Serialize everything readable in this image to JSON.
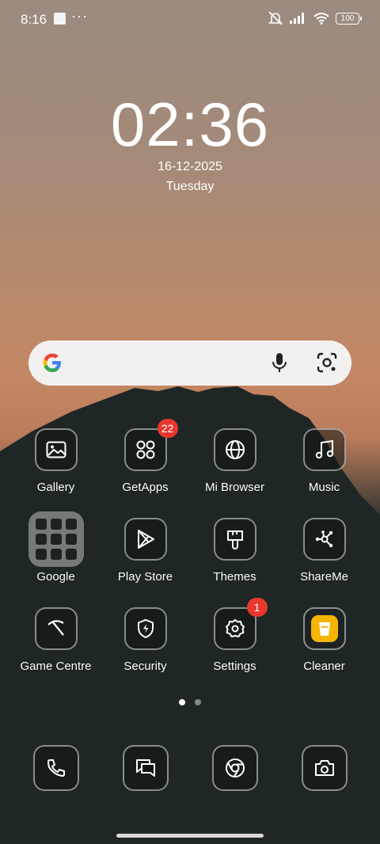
{
  "status": {
    "time": "8:16",
    "more": "···",
    "battery": "100",
    "icons": [
      "notification-square-icon",
      "mute-icon",
      "signal-icon",
      "wifi-icon",
      "battery-icon"
    ]
  },
  "lockscreen": {
    "time": "02:36",
    "date": "16-12-2025",
    "weekday": "Tuesday"
  },
  "search": {
    "icons": [
      "google-icon",
      "mic-icon",
      "lens-icon"
    ]
  },
  "apps": [
    {
      "label": "Gallery",
      "icon": "gallery-icon"
    },
    {
      "label": "GetApps",
      "icon": "getapps-icon",
      "badge": "22"
    },
    {
      "label": "Mi Browser",
      "icon": "globe-icon"
    },
    {
      "label": "Music",
      "icon": "music-icon"
    },
    {
      "label": "Google",
      "icon": "folder-icon"
    },
    {
      "label": "Play Store",
      "icon": "play-store-icon"
    },
    {
      "label": "Themes",
      "icon": "brush-icon"
    },
    {
      "label": "ShareMe",
      "icon": "shareme-icon"
    },
    {
      "label": "Game Centre",
      "icon": "game-centre-icon"
    },
    {
      "label": "Security",
      "icon": "shield-icon"
    },
    {
      "label": "Settings",
      "icon": "gear-icon",
      "badge": "1"
    },
    {
      "label": "Cleaner",
      "icon": "trash-icon"
    }
  ],
  "dock": [
    {
      "icon": "phone-icon"
    },
    {
      "icon": "messages-icon"
    },
    {
      "icon": "chrome-icon"
    },
    {
      "icon": "camera-icon"
    }
  ],
  "pages": {
    "count": 2,
    "active": 1
  },
  "colors": {
    "badge": "#e8382e",
    "cleaner": "#f7b500",
    "search_bg": "#f3f1ef"
  }
}
